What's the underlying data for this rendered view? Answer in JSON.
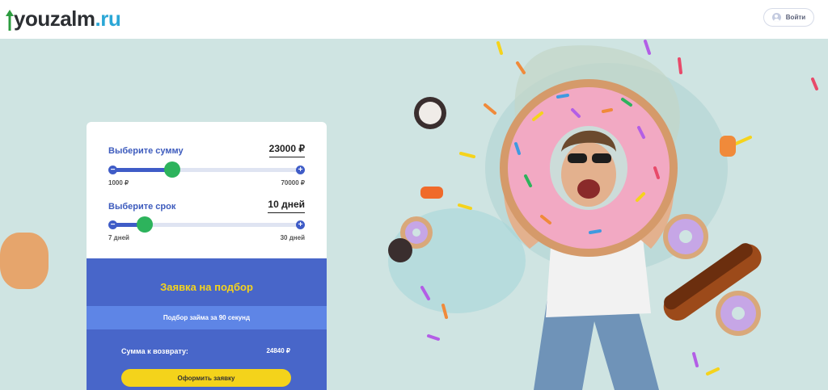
{
  "header": {
    "logo_main": "youzalm",
    "logo_tld": ".ru",
    "login_label": "Войти"
  },
  "form": {
    "amount": {
      "label": "Выберите сумму",
      "value": "23000 ₽",
      "min_label": "1000 ₽",
      "max_label": "70000 ₽",
      "minus": "−",
      "plus": "+",
      "level": 0.319
    },
    "term": {
      "label": "Выберите срок",
      "value": "10 дней",
      "min_label": "7 дней",
      "max_label": "30 дней",
      "minus": "−",
      "plus": "+",
      "level": 0.174
    },
    "apply_title": "Заявка на подбор",
    "strip_text": "Подбор займа за 90 секунд",
    "repay_label": "Сумма к возврату:",
    "repay_value": "24840 ₽",
    "submit_label": "Оформить заявку"
  },
  "colors": {
    "accent": "#3f5cc7",
    "thumb": "#2db35c",
    "panel": "#4866c9",
    "strip": "#5e85e6",
    "button": "#f4d31b",
    "title_yellow": "#f5d31c",
    "hero_bg": "#cfe4e2"
  },
  "icons": [
    "logo-arrow-icon",
    "user-icon",
    "minus-icon",
    "plus-icon"
  ]
}
